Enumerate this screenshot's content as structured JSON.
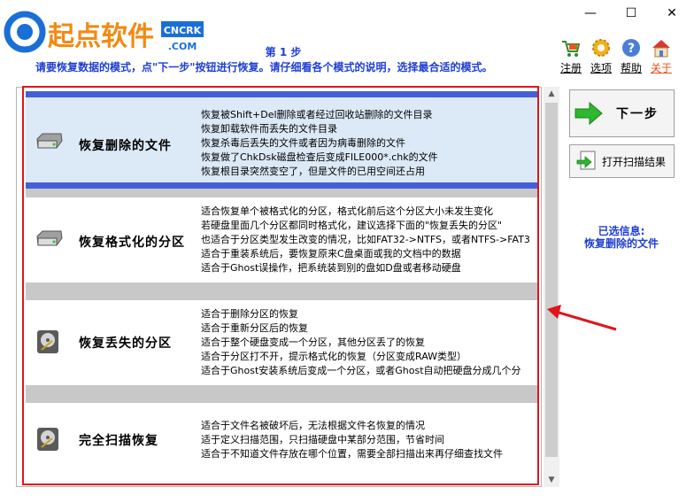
{
  "logo": {
    "main": "起点软件",
    "badge_top": "CNCRK",
    "badge_bottom": ".COM",
    "mark": "G"
  },
  "window": {
    "min": "—",
    "max": "☐",
    "close": "✕"
  },
  "header": {
    "step_title": "第 1 步",
    "step_desc": "请要恢复数据的模式，点\"下一步\"按钮进行恢复。请仔细看各个模式的说明，选择最合适的模式。"
  },
  "tools": [
    {
      "label": "注册",
      "icon": "cart-icon"
    },
    {
      "label": "选项",
      "icon": "gear-icon"
    },
    {
      "label": "帮助",
      "icon": "help-icon"
    },
    {
      "label": "关于",
      "icon": "home-icon"
    }
  ],
  "options": [
    {
      "title": "恢复删除的文件",
      "lines": [
        "恢复被Shift+Del删除或者经过回收站删除的文件目录",
        "恢复卸载软件而丢失的文件目录",
        "恢复杀毒后丢失的文件或者因为病毒删除的文件",
        "恢复做了ChkDsk磁盘检查后变成FILE000*.chk的文件",
        "恢复根目录突然变空了，但是文件的已用空间还占用"
      ]
    },
    {
      "title": "恢复格式化的分区",
      "lines": [
        "适合恢复单个被格式化的分区，格式化前后这个分区大小未发生变化",
        "若硬盘里面几个分区都同时格式化，建议选择下面的\"恢复丢失的分区\"",
        "也适合于分区类型发生改变的情况，比如FAT32->NTFS，或者NTFS->FAT3",
        "适合于重装系统后，要恢复原来C盘桌面或我的文档中的数据",
        "适合于Ghost误操作，把系统装到别的盘如D盘或者移动硬盘"
      ]
    },
    {
      "title": "恢复丢失的分区",
      "lines": [
        "适合于删除分区的恢复",
        "适合于重新分区后的恢复",
        "适合于整个硬盘变成一个分区，其他分区丢了的恢复",
        "适合于分区打不开，提示格式化的恢复（分区变成RAW类型）",
        "适合于Ghost安装系统后变成一个分区，或者Ghost自动把硬盘分成几个分"
      ]
    },
    {
      "title": "完全扫描恢复",
      "lines": [
        "适合于文件名被破坏后，无法根据文件名恢复的情况",
        "适于定义扫描范围，只扫描硬盘中某部分范围，节省时间",
        "适合于不知道文件存放在哪个位置，需要全部扫描出来再仔细查找文件"
      ]
    }
  ],
  "buttons": {
    "next": "下一步",
    "open_scan": "打开扫描结果"
  },
  "info": {
    "label": "已选信息:",
    "value": "恢复删除的文件"
  },
  "colors": {
    "accent": "#1f3fd1",
    "selection_bar": "#4360d9",
    "annotation": "#e0161a"
  }
}
